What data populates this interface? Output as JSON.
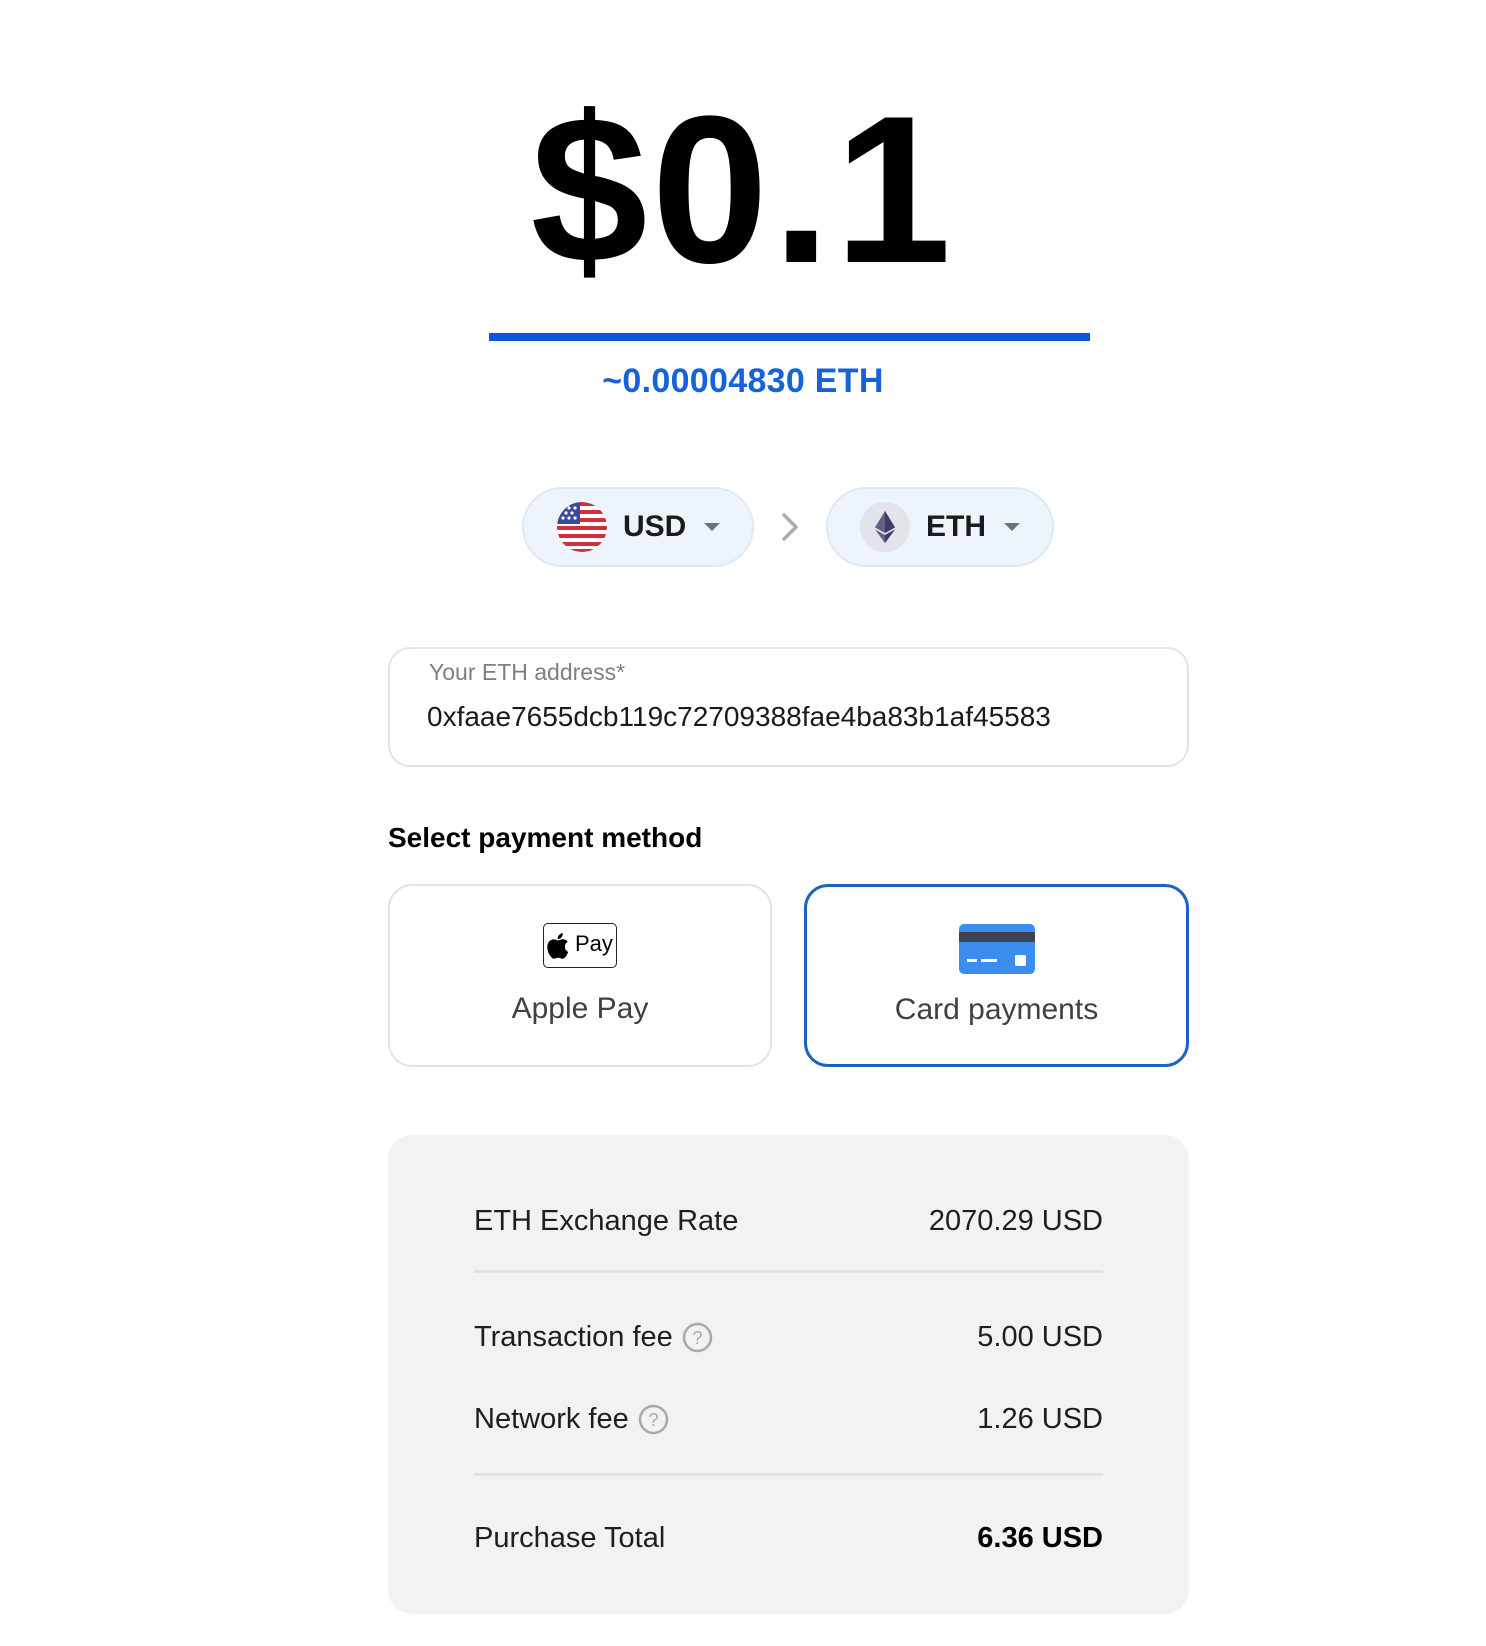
{
  "amount": {
    "value": "$0.1",
    "crypto_estimate": "~0.00004830 ETH"
  },
  "currency_selector": {
    "from": {
      "code": "USD",
      "icon": "us-flag-icon"
    },
    "to": {
      "code": "ETH",
      "icon": "ethereum-icon"
    },
    "separator_icon": "chevron-right-icon"
  },
  "address_field": {
    "label": "Your ETH address*",
    "value": "0xfaae7655dcb119c72709388fae4ba83b1af45583"
  },
  "payment": {
    "title": "Select payment method",
    "methods": [
      {
        "label": "Apple Pay",
        "icon": "apple-pay-icon",
        "badge_text": "Pay",
        "selected": false
      },
      {
        "label": "Card payments",
        "icon": "credit-card-icon",
        "selected": true
      }
    ],
    "accent_color": "#1f5fc7"
  },
  "summary": {
    "exchange_rate": {
      "label": "ETH Exchange Rate",
      "value": "2070.29 USD"
    },
    "transaction_fee": {
      "label": "Transaction fee",
      "value": "5.00 USD"
    },
    "network_fee": {
      "label": "Network fee",
      "value": "1.26 USD"
    },
    "total": {
      "label": "Purchase Total",
      "value": "6.36 USD"
    }
  },
  "colors": {
    "brand_blue": "#1662d8",
    "pill_background": "#edf4fb",
    "summary_background": "#f2f2f3"
  }
}
